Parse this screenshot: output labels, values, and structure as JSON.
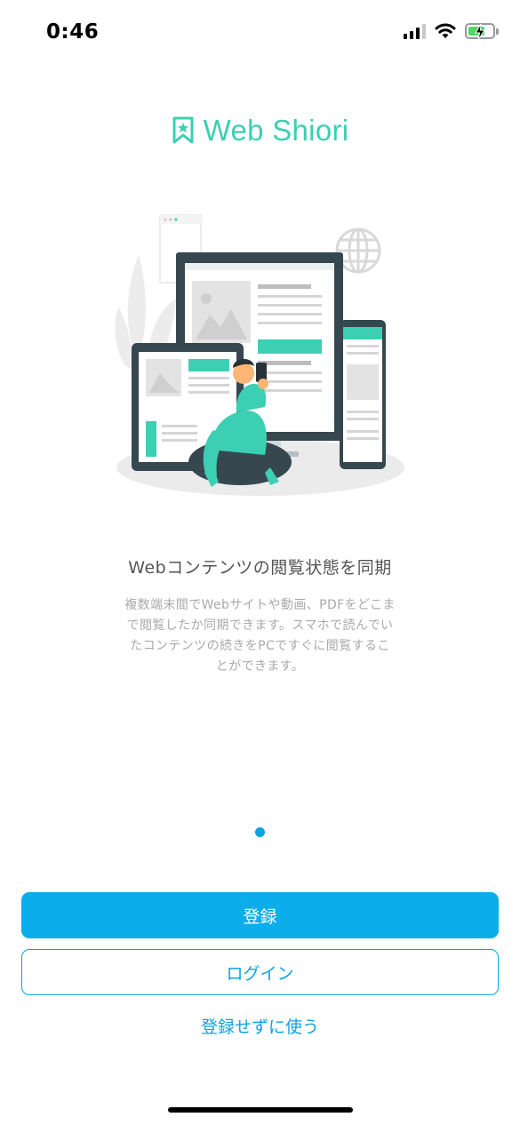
{
  "status_bar": {
    "time": "0:46",
    "signal_icon": "cellular-signal-icon",
    "wifi_icon": "wifi-icon",
    "battery_icon": "battery-charging-icon",
    "battery_level": 0.6
  },
  "logo": {
    "icon": "bookmark-star-icon",
    "text": "Web Shiori",
    "color": "#3ccfb3"
  },
  "illustration": {
    "icon": "multi-device-illustration",
    "accent_color": "#3ccfb3"
  },
  "onboarding": {
    "headline": "Webコンテンツの閲覧状態を同期",
    "description_lines": [
      "複数端末間でWebサイトや動画、PDFをどこま",
      "で閲覧したか同期できます。スマホで読んでい",
      "たコンテンツの続きをPCですぐに閲覧するこ",
      "とができます。"
    ]
  },
  "pagination": {
    "current": 1,
    "total": 1,
    "active_color": "#0ba3e4"
  },
  "actions": {
    "register_label": "登録",
    "login_label": "ログイン",
    "skip_label": "登録せずに使う",
    "primary_color": "#0badea"
  }
}
